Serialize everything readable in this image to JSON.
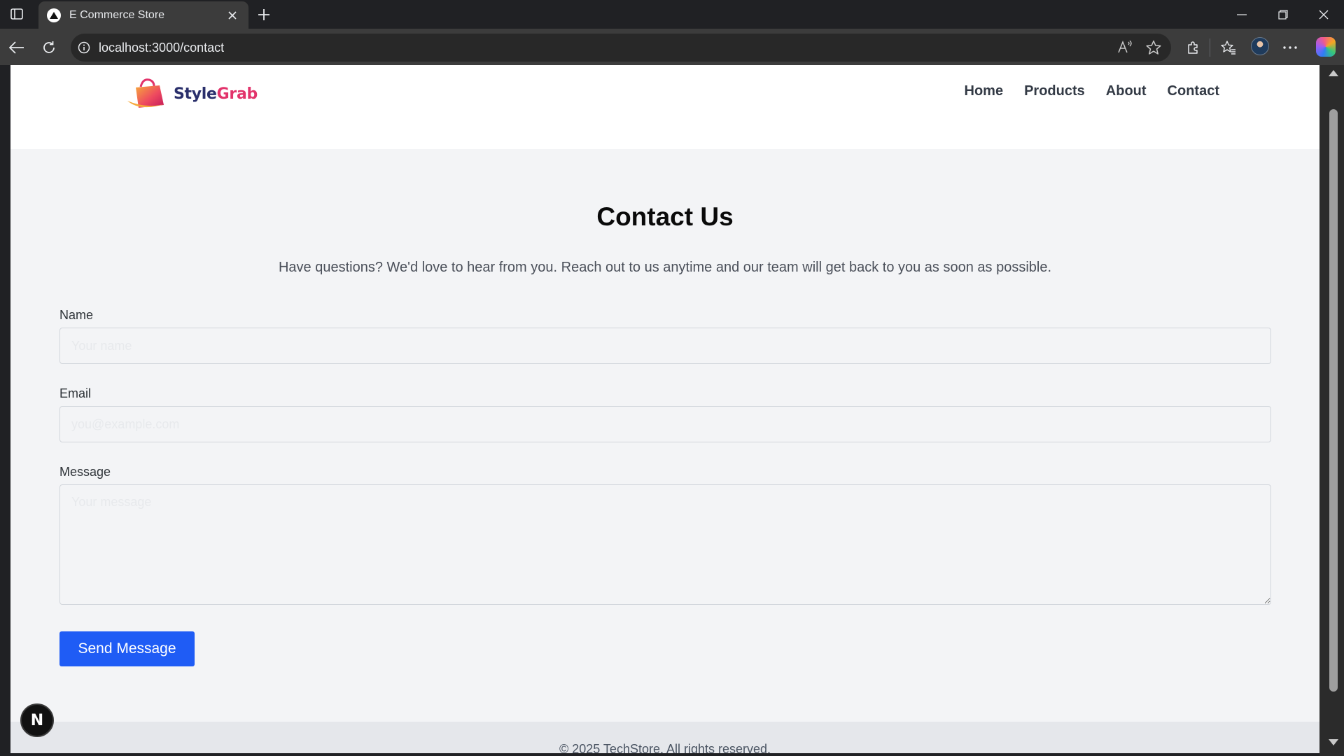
{
  "browser": {
    "tab_title": "E Commerce Store",
    "url": "localhost:3000/contact"
  },
  "site": {
    "logo": {
      "part1": "Style",
      "part2": "Grab"
    },
    "nav": [
      {
        "label": "Home"
      },
      {
        "label": "Products"
      },
      {
        "label": "About"
      },
      {
        "label": "Contact"
      }
    ]
  },
  "contact": {
    "title": "Contact Us",
    "intro": "Have questions? We'd love to hear from you. Reach out to us anytime and our team will get back to you as soon as possible.",
    "name_label": "Name",
    "name_placeholder": "Your name",
    "email_label": "Email",
    "email_placeholder": "you@example.com",
    "message_label": "Message",
    "message_placeholder": "Your message",
    "submit_label": "Send Message"
  },
  "footer": {
    "text": "© 2025 TechStore. All rights reserved."
  },
  "dev_badge": {
    "letter": "N"
  },
  "colors": {
    "accent_button": "#1f5cf5",
    "page_background": "#f3f4f6",
    "header_background": "#ffffff",
    "footer_background": "#e5e7eb",
    "logo_dark": "#2a2f6b",
    "logo_pink": "#e2336b"
  },
  "icons": {
    "tab_actions": "tab-actions-icon",
    "favicon": "nextjs-triangle-icon",
    "tab_close": "close-icon",
    "new_tab": "plus-icon",
    "back": "arrow-left-icon",
    "reload": "reload-icon",
    "site_info": "info-icon",
    "read_aloud": "read-aloud-icon",
    "favorite": "star-icon",
    "extensions": "puzzle-icon",
    "favorites_hub": "favorites-icon",
    "more": "more-dots-icon"
  }
}
